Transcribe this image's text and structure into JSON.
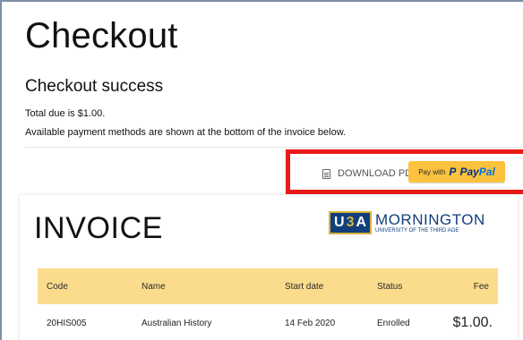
{
  "page": {
    "title": "Checkout",
    "subtitle": "Checkout success",
    "total_line": "Total due is $1.00.",
    "payment_line": "Available payment methods are shown at the bottom of the invoice below."
  },
  "actions": {
    "download_label": "DOWNLOAD PDF",
    "paypal_prefix": "Pay with",
    "paypal_icon": "P",
    "paypal_brand_1": "Pay",
    "paypal_brand_2": "Pal"
  },
  "invoice": {
    "title": "INVOICE",
    "logo_u": "U",
    "logo_3": "3",
    "logo_a": "A",
    "logo_main": "MORNINGTON",
    "logo_sub": "UNIVERSITY OF THE THIRD AGE",
    "columns": [
      "Code",
      "Name",
      "Start date",
      "Status",
      "Fee"
    ],
    "rows": [
      {
        "code": "20HIS005",
        "name": "Australian History",
        "start_date": "14 Feb 2020",
        "status": "Enrolled",
        "fee": "$1.00."
      }
    ]
  },
  "colors": {
    "paypal_yellow": "#fcc23e",
    "paypal_blue_dark": "#003087",
    "paypal_blue_light": "#0070e0",
    "table_header": "#fbdc8d",
    "highlight_red": "#ea1b1b",
    "u3a_blue": "#123f7c",
    "u3a_gold": "#d7b53c"
  },
  "icons": {
    "download": "document-icon",
    "paypal": "paypal-logo-icon"
  }
}
